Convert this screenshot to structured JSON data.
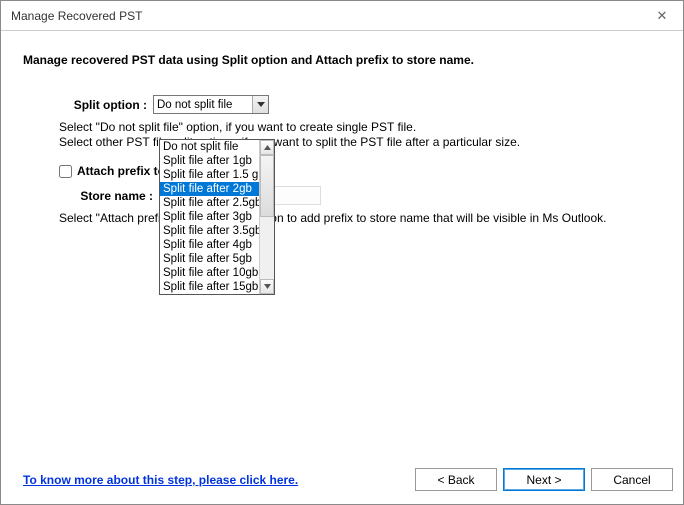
{
  "window": {
    "title": "Manage Recovered PST"
  },
  "subtitle": "Manage recovered PST data using Split option and Attach prefix to store name.",
  "split": {
    "label": "Split option :",
    "value": "Do not split file",
    "options": [
      "Do not split file",
      "Split file after 1gb",
      "Split file after 1.5 gb",
      "Split file after 2gb",
      "Split file after 2.5gb",
      "Split file after 3gb",
      "Split file after 3.5gb",
      "Split file after 4gb",
      "Split file after 5gb",
      "Split file after 10gb",
      "Split file after 15gb"
    ],
    "highlighted_index": 3
  },
  "instructions": {
    "line1_a": "Select \"Do not split file\" option, if you want to create single PST file.",
    "line1_b": "Select other PST file split options, if you want to split the PST file after a particular size."
  },
  "attach_prefix": {
    "checkbox_label": "Attach prefix to store name",
    "checked": false,
    "store_label": "Store name :",
    "store_value": "",
    "note": "Select \"Attach prefix to store name\" option to add prefix to store name that will be visible in Ms Outlook."
  },
  "footer": {
    "link": "To know more about this step, please click here.",
    "back": "< Back",
    "next": "Next >",
    "cancel": "Cancel"
  }
}
